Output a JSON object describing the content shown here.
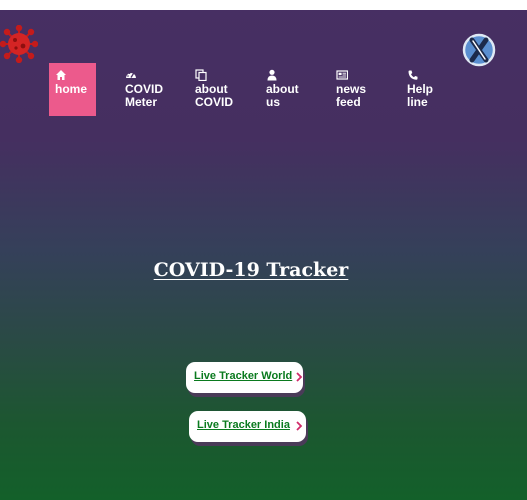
{
  "nav": {
    "items": [
      {
        "label": "home",
        "icon": "home-icon",
        "active": true
      },
      {
        "label": "COVID\nMeter",
        "icon": "tachometer-icon",
        "active": false
      },
      {
        "label": "about\nCOVID",
        "icon": "copy-icon",
        "active": false
      },
      {
        "label": "about\nus",
        "icon": "user-icon",
        "active": false
      },
      {
        "label": "news\nfeed",
        "icon": "newspaper-icon",
        "active": false
      },
      {
        "label": "Help\nline",
        "icon": "phone-icon",
        "active": false
      }
    ]
  },
  "main": {
    "title": "COVID-19 Tracker",
    "buttons": [
      {
        "label": "Live Tracker World"
      },
      {
        "label": "Live Tracker India"
      }
    ]
  },
  "colors": {
    "active_nav": "#ec5a8c",
    "link_green": "#0a7a1e",
    "bg_top": "#472f63",
    "bg_bottom": "#13602a"
  }
}
